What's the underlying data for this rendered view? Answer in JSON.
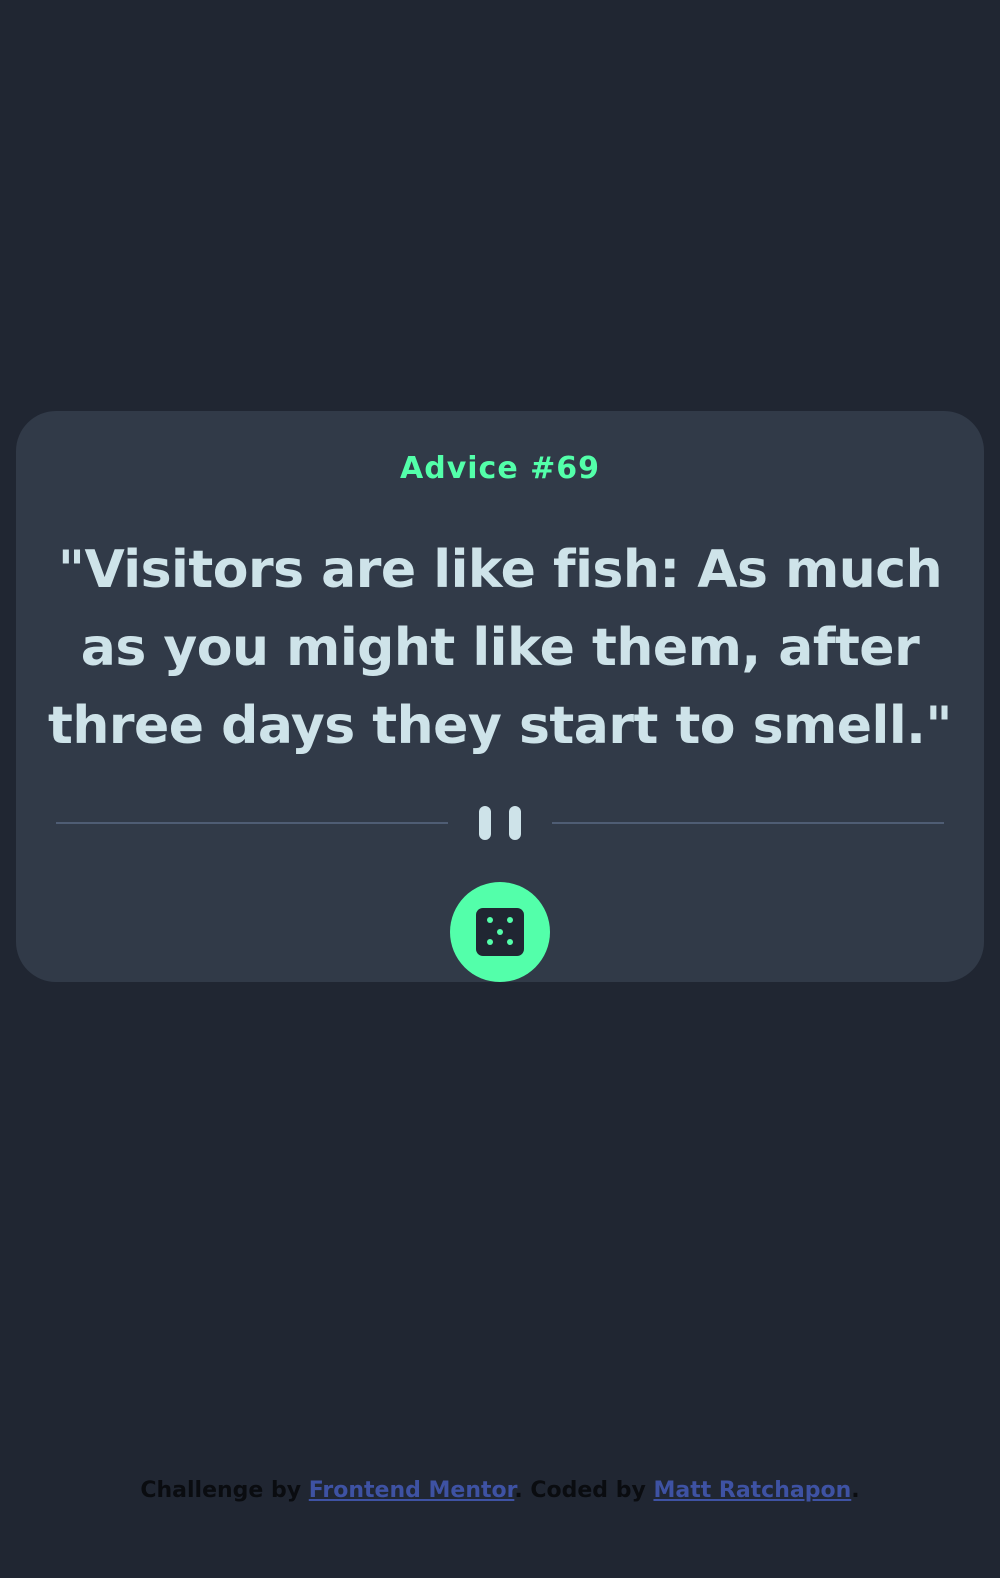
{
  "advice": {
    "id_label": "Advice #69",
    "quote": "\"Visitors are like fish: As much as you might like them, after three days they start to smell.\""
  },
  "controls": {
    "dice_icon": "dice-icon",
    "divider_icon": "pause-icon"
  },
  "attribution": {
    "prefix": "Challenge by ",
    "link1": "Frontend Mentor",
    "middle": ". Coded by ",
    "link2": "Matt Ratchapon",
    "suffix": "."
  },
  "colors": {
    "background": "#202632",
    "card": "#313a48",
    "accent": "#53ffaa",
    "text": "#cee3e9",
    "divider": "#4f5d74",
    "link": "#3e52a3"
  }
}
